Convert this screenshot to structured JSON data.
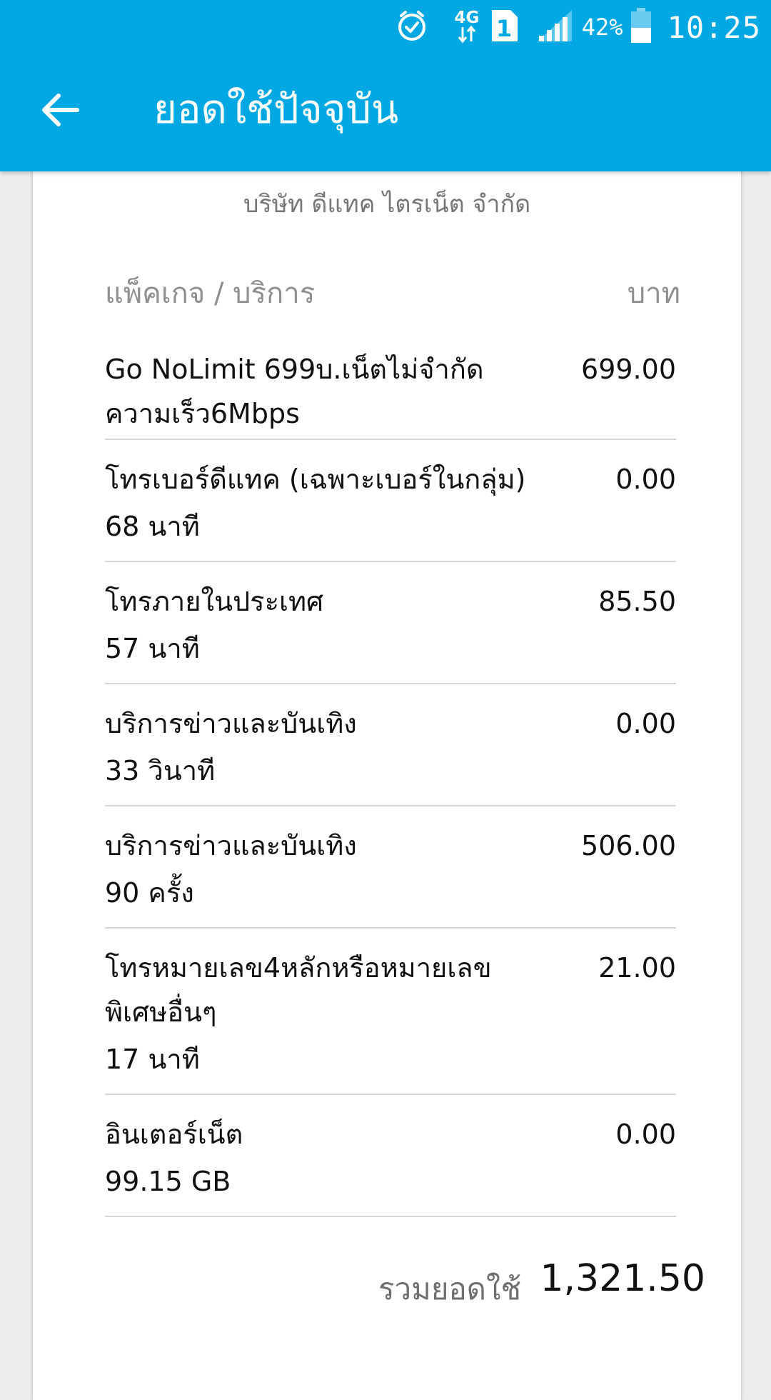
{
  "status_bar": {
    "network": "4G",
    "sim_slot": "1",
    "battery_percent": "42%",
    "time": "10:25",
    "icons": [
      "alarm-icon",
      "network-4g-icon",
      "sim-icon",
      "signal-icon",
      "battery-icon"
    ]
  },
  "header": {
    "title": "ยอดใช้ปัจจุบัน",
    "back_icon": "arrow-left-icon"
  },
  "bill": {
    "company": "บริษัท ดีแทค ไตรเน็ต จำกัด",
    "col_item": "แพ็คเกจ / บริการ",
    "col_amount": "บาท",
    "items": [
      {
        "name": "Go NoLimit 699บ.เน็ตไม่จำกัดความเร็ว6Mbps",
        "detail": "",
        "amount": "699.00"
      },
      {
        "name": "โทรเบอร์ดีแทค (เฉพาะเบอร์ในกลุ่ม)",
        "detail": "68  นาที",
        "amount": "0.00"
      },
      {
        "name": "โทรภายในประเทศ",
        "detail": "57  นาที",
        "amount": "85.50"
      },
      {
        "name": "บริการข่าวและบันเทิง",
        "detail": "33  วินาที",
        "amount": "0.00"
      },
      {
        "name": "บริการข่าวและบันเทิง",
        "detail": "90  ครั้ง",
        "amount": "506.00"
      },
      {
        "name": "โทรหมายเลข4หลักหรือหมายเลขพิเศษอื่นๆ",
        "detail": "17  นาที",
        "amount": "21.00"
      },
      {
        "name": "อินเตอร์เน็ต",
        "detail": "99.15  GB",
        "amount": "0.00"
      }
    ],
    "total_label": "รวมยอดใช้",
    "total_value": "1,321.50"
  },
  "colors": {
    "appbar": "#00a8e3",
    "card": "#ffffff",
    "background": "#ededed"
  }
}
